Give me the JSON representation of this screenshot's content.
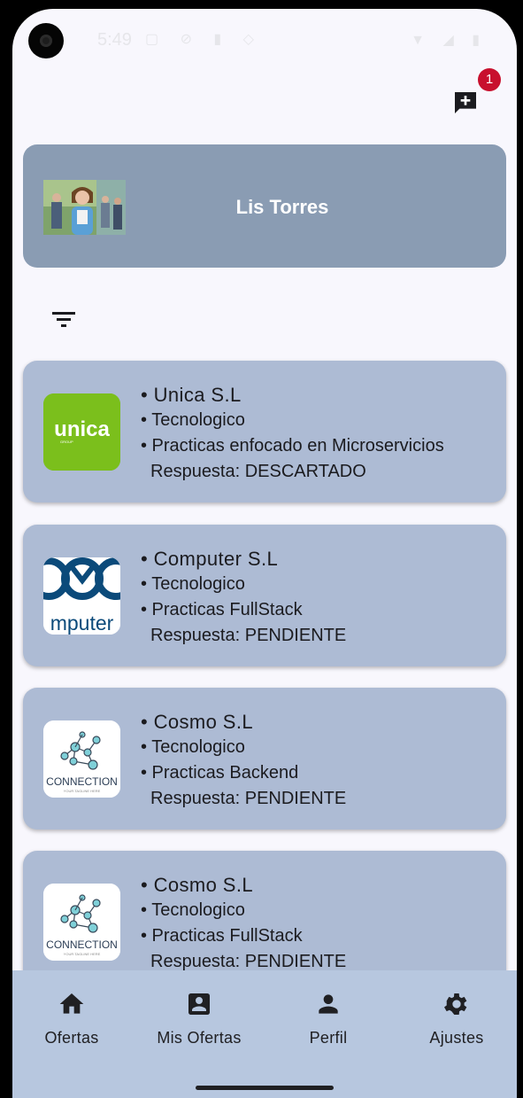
{
  "status_bar": {
    "time": "5:49"
  },
  "header": {
    "notification_count": "1"
  },
  "profile": {
    "name": "Lis Torres"
  },
  "offers": [
    {
      "company": "• Unica S.L",
      "sector": "• Tecnologico",
      "title": "• Practicas enfocado en Microservicios",
      "response": "Respuesta: DESCARTADO",
      "logo": "unica-logo"
    },
    {
      "company": "• Computer S.L",
      "sector": "• Tecnologico",
      "title": "• Practicas FullStack",
      "response": "Respuesta: PENDIENTE",
      "logo": "computer-logo"
    },
    {
      "company": "• Cosmo S.L",
      "sector": "• Tecnologico",
      "title": "• Practicas Backend",
      "response": "Respuesta: PENDIENTE",
      "logo": "connection-logo"
    },
    {
      "company": "• Cosmo S.L",
      "sector": "• Tecnologico",
      "title": "• Practicas FullStack",
      "response": "Respuesta: PENDIENTE",
      "logo": "connection-logo"
    }
  ],
  "logos": {
    "unica_text": "unica",
    "unica_sub": "GROUP",
    "computer_text": "mputer",
    "connection_text": "CONNECTION",
    "connection_tagline": "YOUR TAGLINE HERE"
  },
  "bottom_nav": [
    {
      "label": "Ofertas",
      "icon": "home-icon"
    },
    {
      "label": "Mis Ofertas",
      "icon": "contact-card-icon"
    },
    {
      "label": "Perfil",
      "icon": "person-icon"
    },
    {
      "label": "Ajustes",
      "icon": "gear-icon"
    }
  ],
  "colors": {
    "background": "#f8f7fd",
    "profile_card": "#8a9cb3",
    "offer_card": "#adbbd4",
    "bottom_nav": "#b7c7df",
    "badge": "#c8102e",
    "unica_green": "#7bbf1c"
  }
}
